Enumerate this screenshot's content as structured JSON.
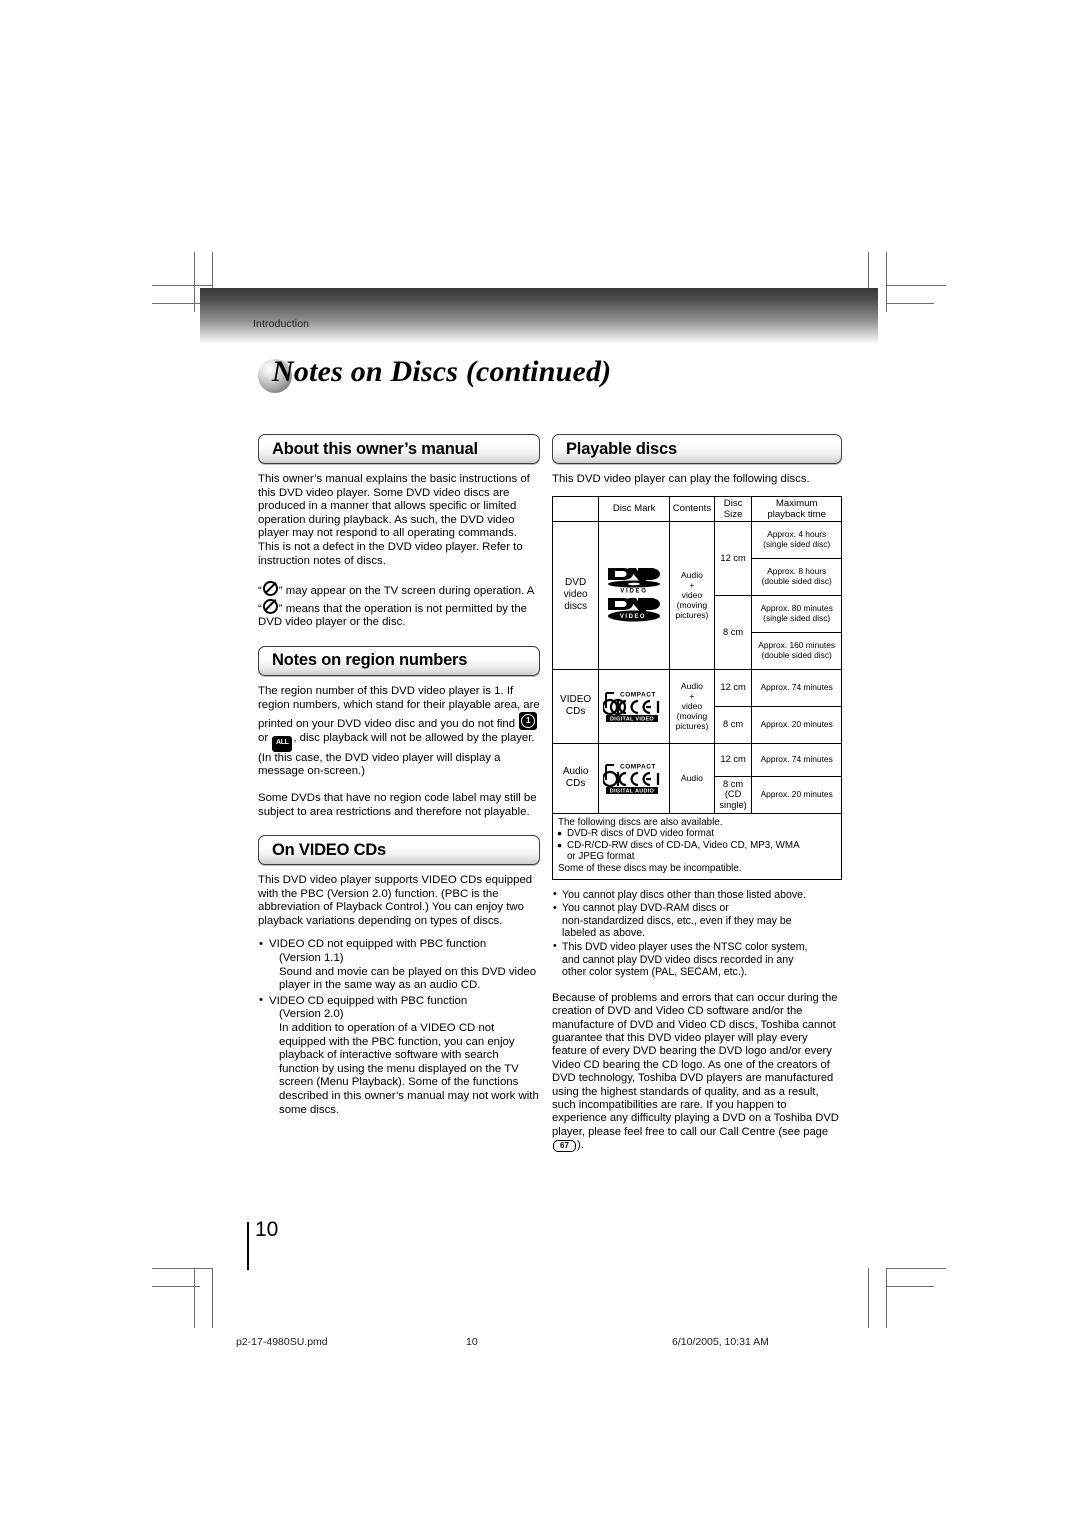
{
  "header": {
    "kicker": "Introduction",
    "title": "Notes on Discs (continued)"
  },
  "left_column": {
    "section1": {
      "heading": "About this owner’s manual",
      "p1": "This owner’s manual explains the basic instructions of this DVD video player. Some DVD video discs are produced in a manner that allows specific or limited operation during playback. As such, the DVD video player may not respond to all operating commands. This is not a defect in the DVD video player. Refer to instruction notes of discs.",
      "p2_a": "“",
      "p2_b": "” may appear on the TV screen during operation. A “",
      "p2_c": "” means that the operation is not permitted by the DVD video player or the disc."
    },
    "section2": {
      "heading": "Notes on region numbers",
      "p1_a": "The region number of this DVD video player is 1. If region numbers, which stand for their playable area, are printed on your DVD video disc and you do not find",
      "p1_b": "or",
      "p1_c": ", disc playback will not be allowed by the player. (In this case, the DVD video player will display a message on-screen.)",
      "region_icon_label": "1",
      "all_icon_label": "ALL",
      "p2": "Some DVDs that have no region code label may still be subject to area restrictions and therefore not playable."
    },
    "section3": {
      "heading": "On VIDEO CDs",
      "p1": "This DVD video player supports VIDEO CDs equipped with the PBC (Version 2.0) function. (PBC is the abbreviation of Playback Control.) You can enjoy two playback variations depending on types of discs.",
      "bullets": [
        {
          "line1": "VIDEO CD not equipped with PBC function",
          "line2": "(Version 1.1)",
          "line3": "Sound and movie can be played on this DVD video player in the same way as an audio CD."
        },
        {
          "line1": "VIDEO CD equipped with PBC function",
          "line2": "(Version 2.0)",
          "line3": "In addition to operation of a VIDEO CD not equipped with the PBC function, you can enjoy playback of interactive software with search function by using the menu displayed on the TV screen (Menu Playback). Some of the functions described in this owner’s manual may not work with some discs."
        }
      ]
    }
  },
  "right_column": {
    "heading": "Playable discs",
    "intro": "This DVD video player can play the following discs.",
    "table": {
      "headers": [
        "",
        "Disc Mark",
        "Contents",
        "Disc Size",
        "Maximum playback time"
      ],
      "header_parts": {
        "disc_mark": "Disc Mark",
        "contents": "Contents",
        "disc_size_l1": "Disc",
        "disc_size_l2": "Size",
        "max_time_l1": "Maximum",
        "max_time_l2": "playback time"
      },
      "rows": [
        {
          "name_l1": "DVD",
          "name_l2": "video",
          "name_l3": "discs",
          "marks": [
            "dvd-video-logo",
            "dvd-video-logo-alt"
          ],
          "contents_l1": "Audio",
          "contents_l2": "+",
          "contents_l3": "video",
          "contents_l4": "(moving",
          "contents_l5": "pictures)",
          "sizes": [
            {
              "size": "12 cm",
              "times": [
                {
                  "l1": "Approx. 4 hours",
                  "l2": "(single sided disc)"
                },
                {
                  "l1": "Approx. 8 hours",
                  "l2": "(double sided disc)"
                }
              ]
            },
            {
              "size": "8 cm",
              "times": [
                {
                  "l1": "Approx. 80 minutes",
                  "l2": "(single sided disc)"
                },
                {
                  "l1": "Approx. 160 minutes",
                  "l2": "(double sided disc)"
                }
              ]
            }
          ]
        },
        {
          "name_l1": "VIDEO",
          "name_l2": "CDs",
          "marks": [
            "compact-disc-digital-video-logo"
          ],
          "contents_l1": "Audio",
          "contents_l2": "+",
          "contents_l3": "video",
          "contents_l4": "(moving",
          "contents_l5": "pictures)",
          "sizes": [
            {
              "size": "12 cm",
              "times": [
                {
                  "l1": "Approx. 74 minutes",
                  "l2": ""
                }
              ]
            },
            {
              "size": "8 cm",
              "times": [
                {
                  "l1": "Approx. 20 minutes",
                  "l2": ""
                }
              ]
            }
          ]
        },
        {
          "name_l1": "Audio",
          "name_l2": "CDs",
          "marks": [
            "compact-disc-digital-audio-logo"
          ],
          "contents_l1": "Audio",
          "sizes": [
            {
              "size": "12 cm",
              "times": [
                {
                  "l1": "Approx. 74 minutes",
                  "l2": ""
                }
              ]
            },
            {
              "size_l1": "8 cm",
              "size_l2": "(CD",
              "size_l3": "single)",
              "times": [
                {
                  "l1": "Approx. 20 minutes",
                  "l2": ""
                }
              ]
            }
          ]
        }
      ]
    },
    "available_box": {
      "intro": "The following discs are also available.",
      "items": [
        "DVD-R discs of DVD video format",
        "CD-R/CD-RW discs of CD-DA, Video CD, MP3, WMA"
      ],
      "item2_cont": "or JPEG format",
      "outro": "Some of these discs may be incompatible."
    },
    "notes": [
      {
        "l1": "You cannot play discs other than those listed above."
      },
      {
        "l1": "You cannot play DVD-RAM discs or",
        "l2": "non-standardized discs, etc., even if they may be",
        "l3": "labeled as above."
      },
      {
        "l1": "This DVD video player uses the NTSC color system,",
        "l2": "and cannot play DVD video discs recorded in any",
        "l3": "other color system (PAL, SECAM, etc.)."
      }
    ],
    "closing_a": "Because of problems and errors that can occur during the creation of DVD and Video CD software and/or the manufacture of DVD and Video CD discs, Toshiba cannot guarantee that this DVD video player will play every feature of every DVD bearing the DVD logo and/or every Video CD bearing the CD logo.  As one of the creators of DVD technology, Toshiba DVD players are manufactured using the highest standards of quality, and as a result, such incompatibilities are rare. If you happen to experience any difficulty playing a DVD on a Toshiba DVD player, please feel free to call our Call Centre (see page ",
    "closing_page_ref": "67",
    "closing_b": ")."
  },
  "page_number": "10",
  "footer": {
    "filename": "p2-17-4980SU.pmd",
    "page": "10",
    "timestamp": "6/10/2005, 10:31 AM"
  },
  "logo_text": {
    "dvd": "DVD",
    "video": "VIDEO",
    "compact": "COMPACT",
    "disc": "disc",
    "digital_video": "DIGITAL VIDEO",
    "digital_audio": "DIGITAL AUDIO",
    "tm": "™"
  }
}
